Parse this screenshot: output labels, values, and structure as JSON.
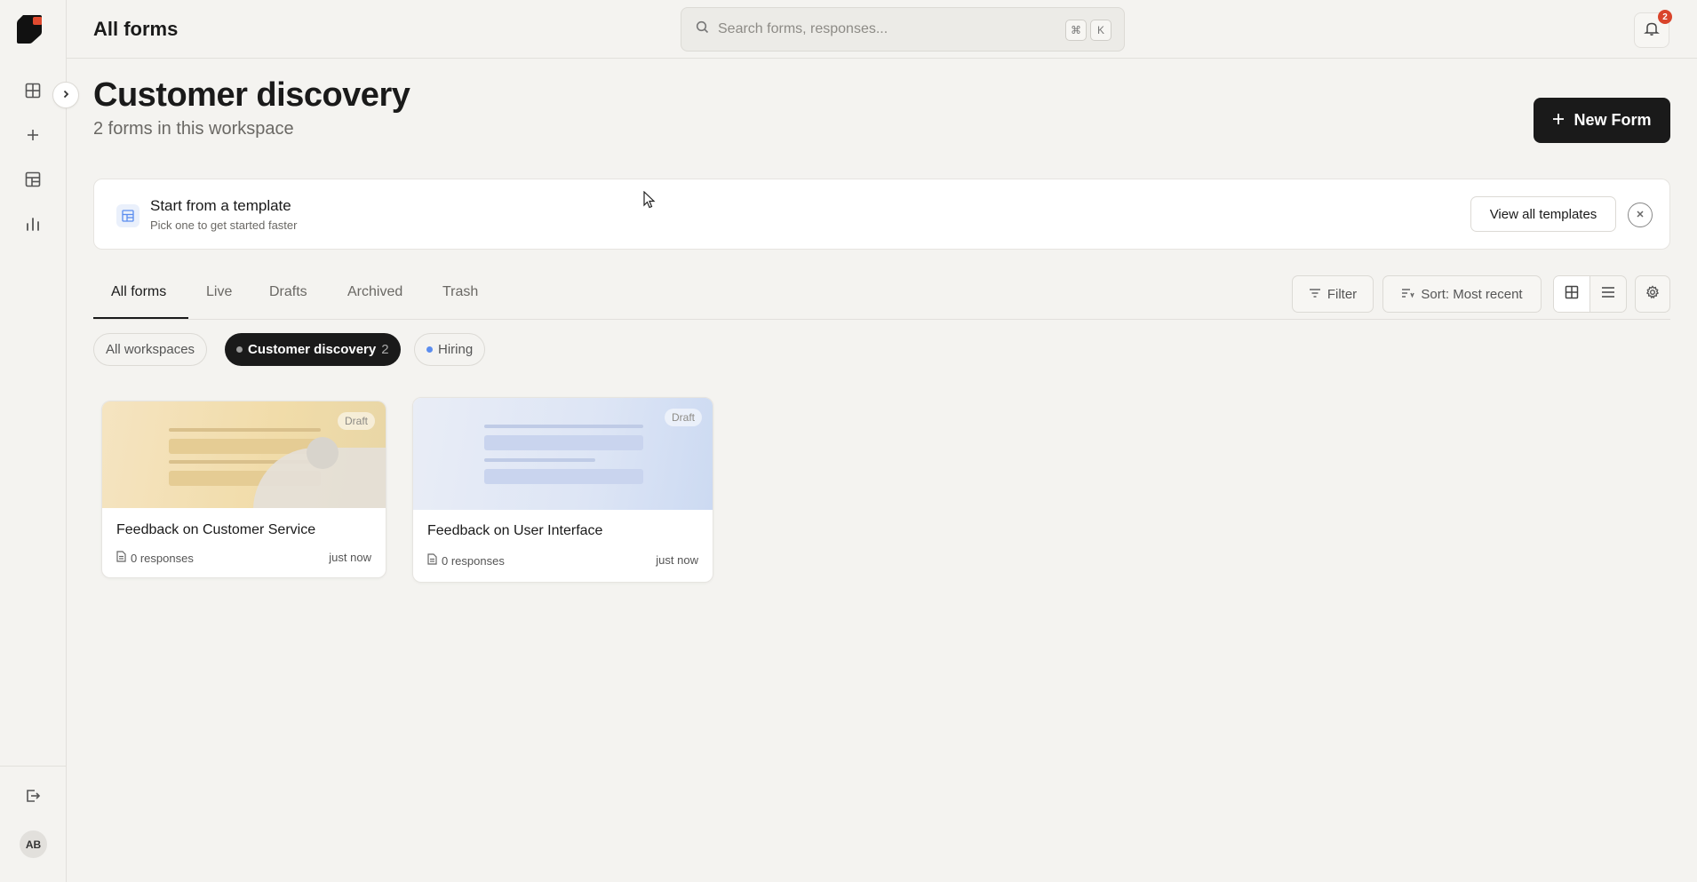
{
  "topbar": {
    "title": "All forms",
    "search_placeholder": "Search forms, responses...",
    "shortcut_cmd": "⌘",
    "shortcut_key": "K",
    "notification_count": "2"
  },
  "sidebar": {
    "avatar_initials": "AB",
    "items": [
      {
        "name": "forms",
        "icon": "grid-icon"
      },
      {
        "name": "create",
        "icon": "plus-icon"
      },
      {
        "name": "templates",
        "icon": "layout-icon"
      },
      {
        "name": "analytics",
        "icon": "bar-chart-icon"
      }
    ]
  },
  "header": {
    "title": "Customer discovery",
    "subtitle": "2 forms in this workspace",
    "new_form_label": "New Form"
  },
  "template_banner": {
    "title": "Start from a template",
    "subtitle": "Pick one to get started faster",
    "view_all_label": "View all templates"
  },
  "tabs": [
    {
      "label": "All forms",
      "active": true
    },
    {
      "label": "Live",
      "active": false
    },
    {
      "label": "Drafts",
      "active": false
    },
    {
      "label": "Archived",
      "active": false
    },
    {
      "label": "Trash",
      "active": false
    }
  ],
  "toolbar": {
    "filter_label": "Filter",
    "sort_label": "Sort: Most recent"
  },
  "workspace_chips": [
    {
      "label": "All workspaces",
      "selected": false
    },
    {
      "label": "Customer discovery",
      "count": "2",
      "selected": true,
      "dot_color": "#9a9a9a"
    },
    {
      "label": "Hiring",
      "selected": false,
      "dot_color": "#5b8def"
    }
  ],
  "forms": [
    {
      "title": "Feedback on Customer Service",
      "status": "Draft",
      "responses": "0 responses",
      "updated": "just now",
      "theme": "warm"
    },
    {
      "title": "Feedback on User Interface",
      "status": "Draft",
      "responses": "0 responses",
      "updated": "just now",
      "theme": "cool"
    }
  ],
  "colors": {
    "accent": "#1a1a1a",
    "background": "#f4f3f0",
    "badge": "#d9442b",
    "brand_mark": "#e04a2f"
  }
}
